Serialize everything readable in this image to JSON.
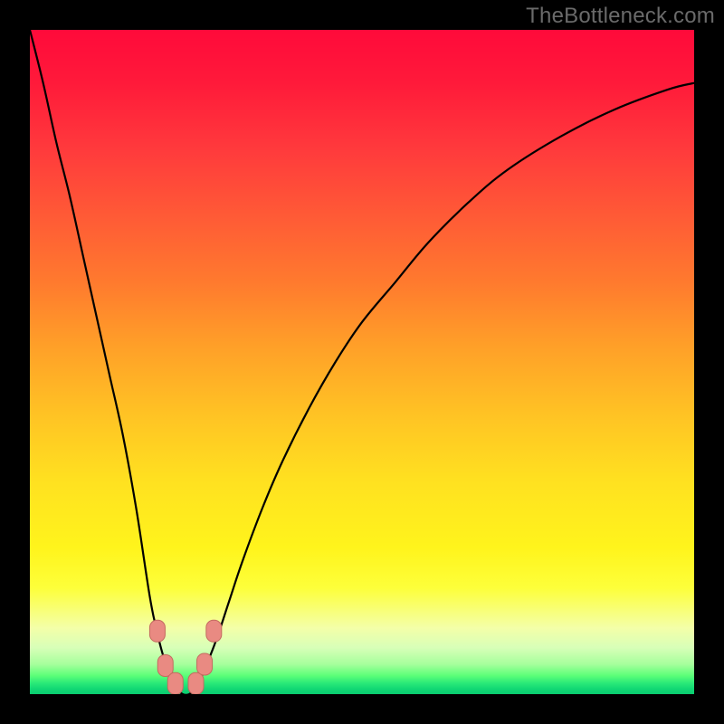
{
  "watermark": {
    "text": "TheBottleneck.com"
  },
  "colors": {
    "background": "#000000",
    "curve_stroke": "#000000",
    "marker_fill": "#e98a82",
    "marker_stroke": "#c46a60"
  },
  "chart_data": {
    "type": "line",
    "title": "",
    "xlabel": "",
    "ylabel": "",
    "xlim": [
      0,
      100
    ],
    "ylim": [
      0,
      100
    ],
    "grid": false,
    "legend": false,
    "note": "Values estimated from pixel positions on an unlabeled axis; y is approximate bottleneck percentage where 0 is at the bottom (green) and 100 at the top (red).",
    "series": [
      {
        "name": "bottleneck-curve",
        "x": [
          0,
          2,
          4,
          6,
          8,
          10,
          12,
          14,
          16,
          18,
          19,
          20,
          21,
          22,
          23,
          24,
          25,
          26,
          28,
          30,
          32,
          35,
          38,
          42,
          46,
          50,
          55,
          60,
          66,
          72,
          80,
          88,
          96,
          100
        ],
        "y": [
          100,
          92,
          83,
          75,
          66,
          57,
          48,
          39,
          28,
          15,
          10,
          6,
          3,
          1,
          0,
          0,
          1,
          3,
          8,
          14,
          20,
          28,
          35,
          43,
          50,
          56,
          62,
          68,
          74,
          79,
          84,
          88,
          91,
          92
        ]
      }
    ],
    "markers": [
      {
        "x": 19.2,
        "y": 9.5
      },
      {
        "x": 20.4,
        "y": 4.3
      },
      {
        "x": 21.9,
        "y": 1.6
      },
      {
        "x": 25.0,
        "y": 1.6
      },
      {
        "x": 26.3,
        "y": 4.5
      },
      {
        "x": 27.7,
        "y": 9.5
      }
    ]
  }
}
